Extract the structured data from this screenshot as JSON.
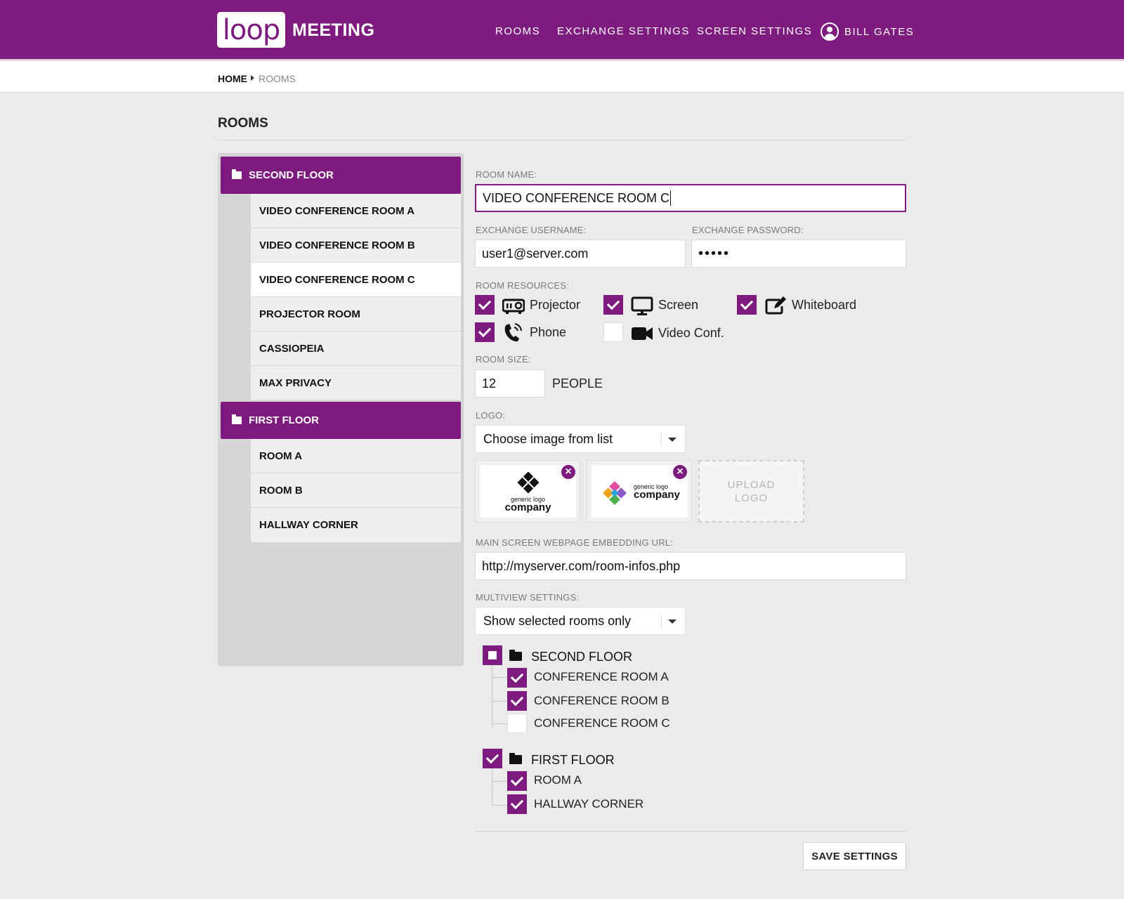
{
  "app": {
    "logo_text": "loop",
    "brand": "MEETING"
  },
  "nav": {
    "rooms": "ROOMS",
    "exchange": "EXCHANGE SETTINGS",
    "screen": "SCREEN SETTINGS",
    "user": "BILL GATES"
  },
  "breadcrumb": {
    "home": "HOME",
    "current": "ROOMS"
  },
  "page": {
    "title": "ROOMS"
  },
  "sidebar": {
    "floors": [
      {
        "label": "SECOND FLOOR",
        "rooms": [
          "VIDEO CONFERENCE ROOM A",
          "VIDEO CONFERENCE ROOM B",
          "VIDEO CONFERENCE ROOM C",
          "PROJECTOR ROOM",
          "CASSIOPEIA",
          "MAX PRIVACY"
        ]
      },
      {
        "label": "FIRST FLOOR",
        "rooms": [
          "ROOM A",
          "ROOM B",
          "HALLWAY CORNER"
        ]
      }
    ],
    "selected_room": "VIDEO CONFERENCE ROOM C"
  },
  "form": {
    "room_name_label": "ROOM NAME:",
    "room_name_value": "VIDEO CONFERENCE ROOM C",
    "exchange_username_label": "EXCHANGE USERNAME:",
    "exchange_username_value": "user1@server.com",
    "exchange_password_label": "EXCHANGE PASSWORD:",
    "exchange_password_value": "•••••",
    "resources_label": "ROOM RESOURCES:",
    "resources": [
      {
        "label": "Projector",
        "icon": "projector-icon",
        "checked": true
      },
      {
        "label": "Screen",
        "icon": "monitor-icon",
        "checked": true
      },
      {
        "label": "Whiteboard",
        "icon": "whiteboard-edit-icon",
        "checked": true
      },
      {
        "label": "Phone",
        "icon": "phone-icon",
        "checked": true
      },
      {
        "label": "Video Conf.",
        "icon": "video-camera-icon",
        "checked": false
      }
    ],
    "room_size_label": "ROOM SIZE:",
    "room_size_value": "12",
    "room_size_unit": "PEOPLE",
    "logo_label": "LOGO:",
    "logo_select_value": "Choose image from list",
    "logos": [
      {
        "small": "generic logo",
        "big": "company",
        "icon": "diamond-logo-icon"
      },
      {
        "small": "generic logo",
        "big": "company",
        "icon": "colorful-diamond-logo-icon"
      }
    ],
    "upload_line1": "UPLOAD",
    "upload_line2": "LOGO",
    "embed_url_label": "MAIN SCREEN WEBPAGE EMBEDDING URL:",
    "embed_url_value": "http://myserver.com/room-infos.php",
    "multiview_label": "MULTIVIEW SETTINGS:",
    "multiview_value": "Show selected rooms only",
    "tree": [
      {
        "label": "SECOND FLOOR",
        "state": "partial",
        "children": [
          {
            "label": "CONFERENCE ROOM A",
            "checked": true
          },
          {
            "label": "CONFERENCE ROOM B",
            "checked": true
          },
          {
            "label": "CONFERENCE ROOM C",
            "checked": false
          }
        ]
      },
      {
        "label": "FIRST FLOOR",
        "state": "checked",
        "children": [
          {
            "label": "ROOM A",
            "checked": true
          },
          {
            "label": "HALLWAY CORNER",
            "checked": true
          }
        ]
      }
    ],
    "save_label": "SAVE SETTINGS"
  },
  "colors": {
    "accent": "#7d1b7e",
    "page_bg": "#ebebeb"
  }
}
